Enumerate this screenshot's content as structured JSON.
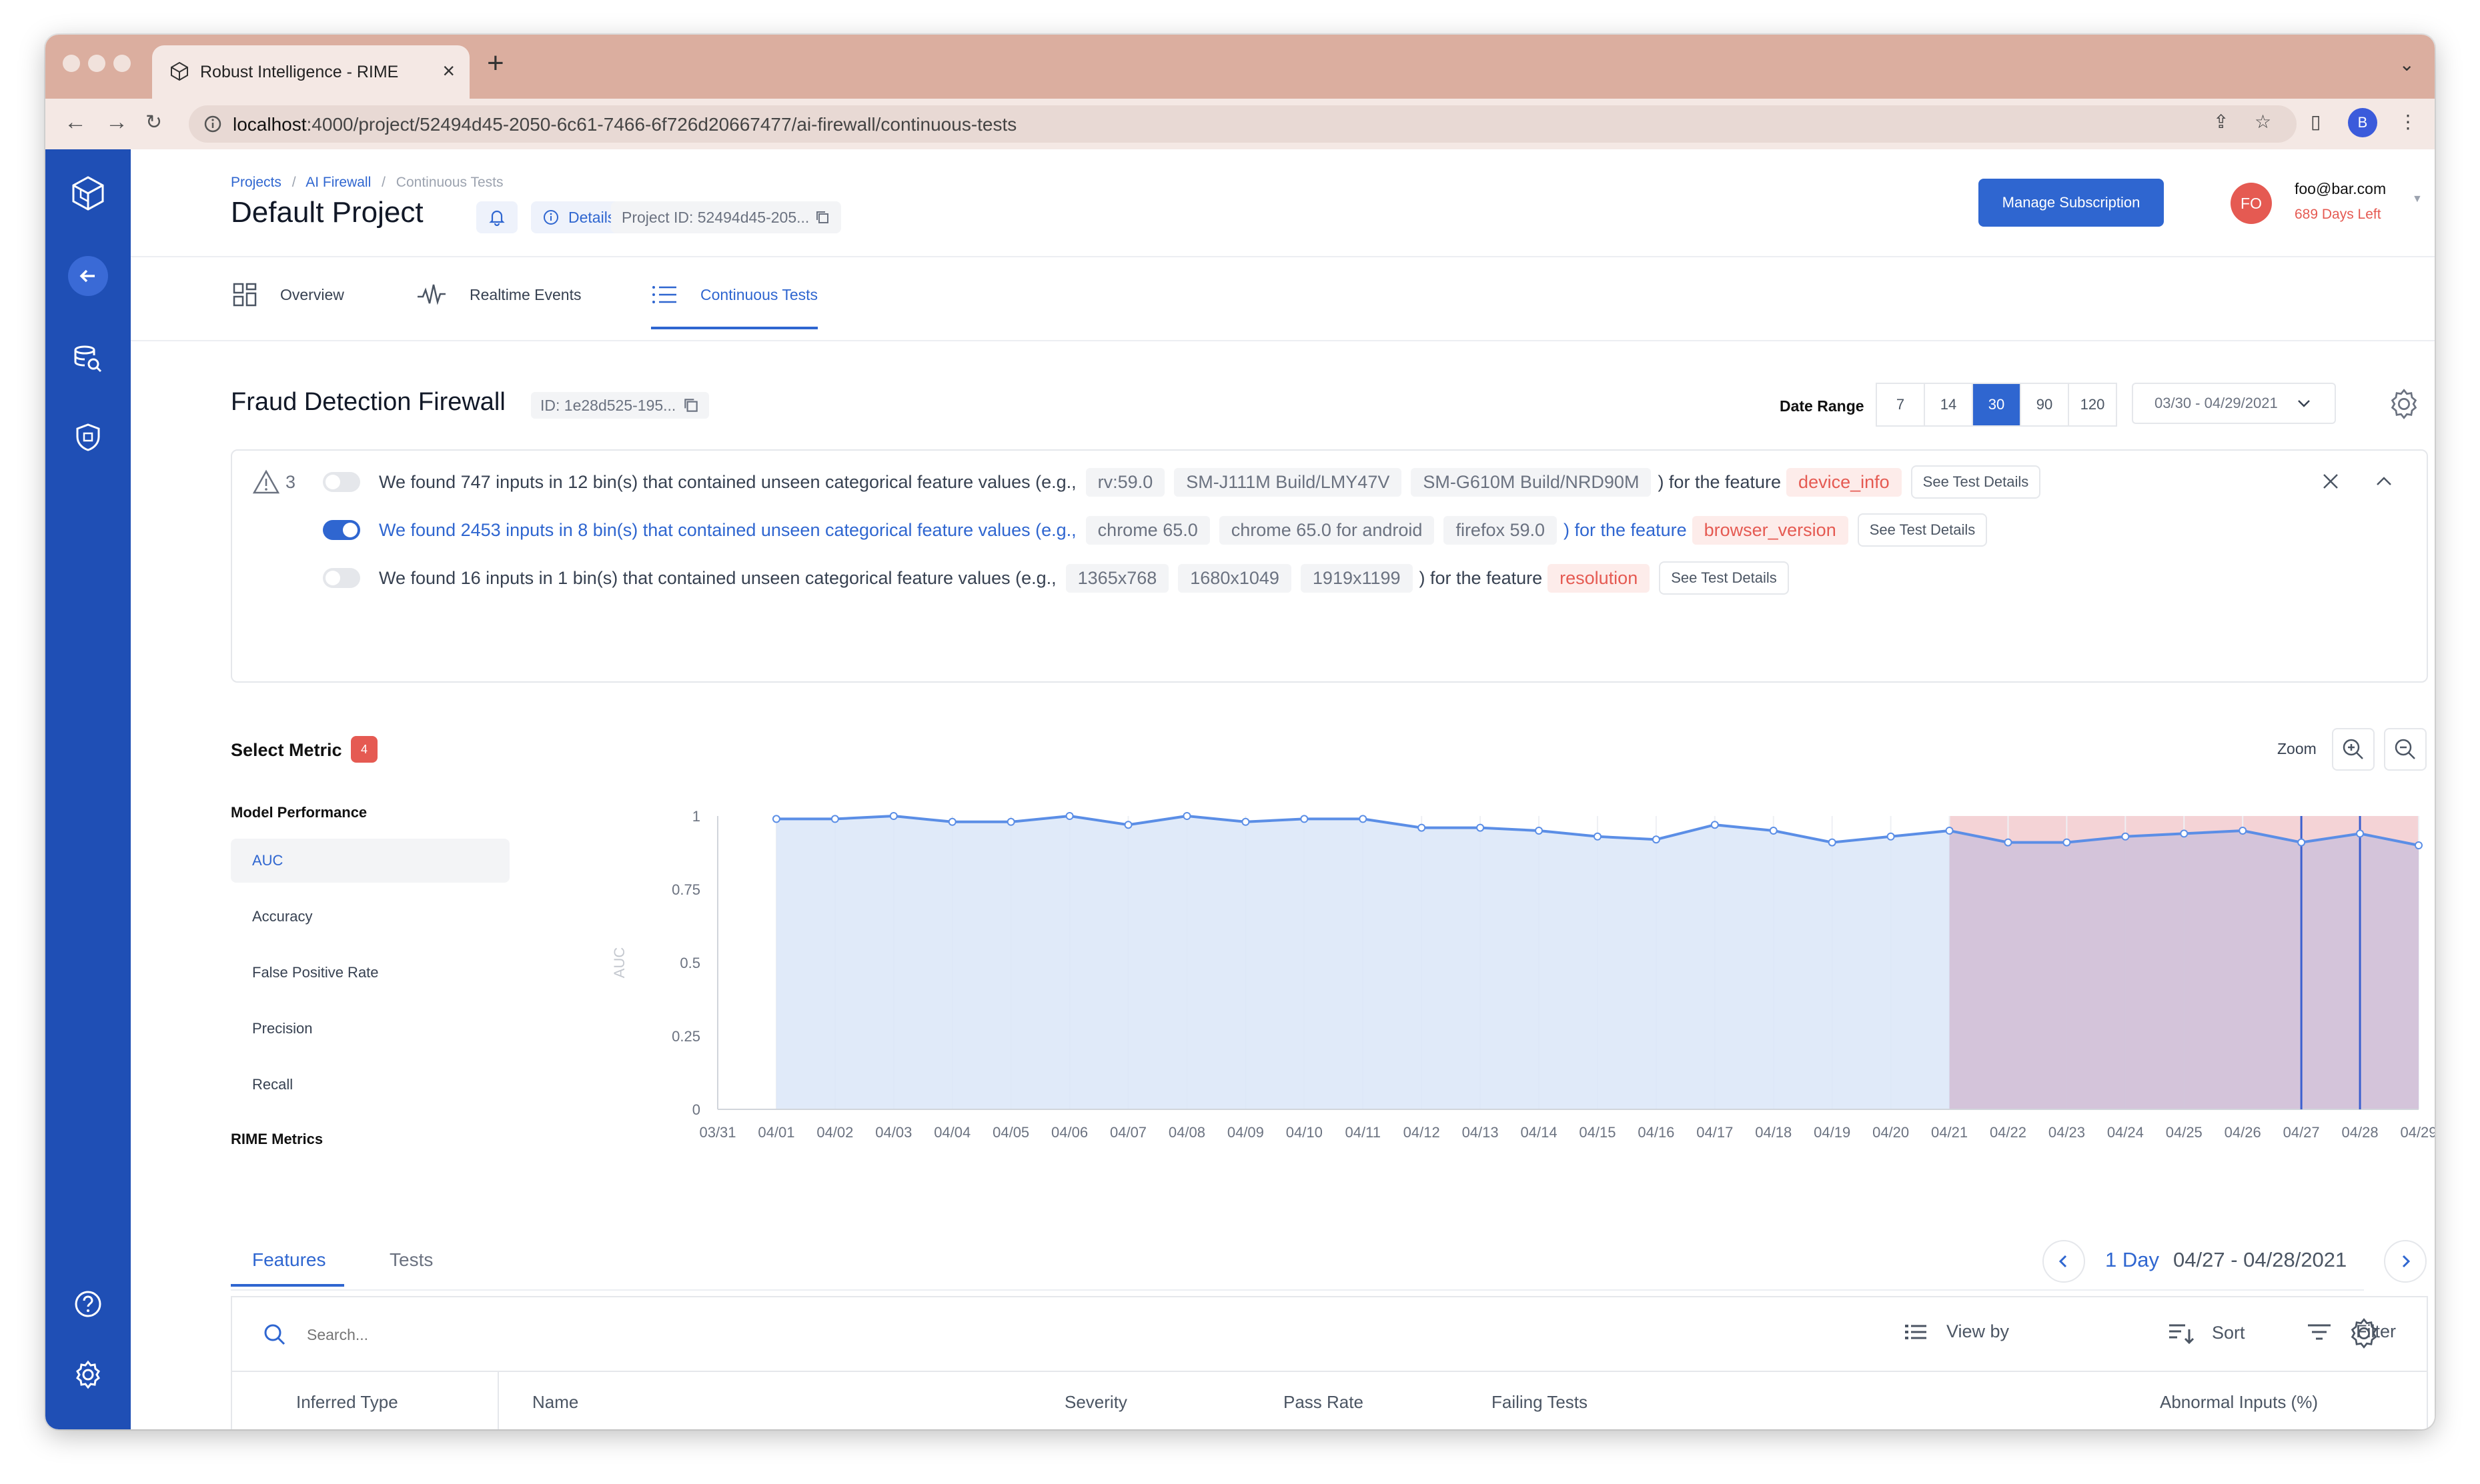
{
  "browser": {
    "tab_title": "Robust Intelligence - RIME",
    "url_host": "localhost",
    "url_rest": ":4000/project/52494d45-2050-6c61-7466-6f726d20667477/ai-firewall/continuous-tests",
    "profile_initial": "B"
  },
  "header": {
    "breadcrumb": [
      "Projects",
      "AI Firewall",
      "Continuous Tests"
    ],
    "project_title": "Default Project",
    "details_label": "Details",
    "project_id": "Project ID: 52494d45-205...",
    "manage_button": "Manage Subscription",
    "avatar_initials": "FO",
    "email": "foo@bar.com",
    "days_left": "689 Days Left"
  },
  "nav_tabs": [
    {
      "label": "Overview"
    },
    {
      "label": "Realtime Events"
    },
    {
      "label": "Continuous Tests"
    }
  ],
  "firewall": {
    "title": "Fraud Detection Firewall",
    "id": "ID: 1e28d525-195...",
    "date_range_label": "Date Range",
    "range_options": [
      "7",
      "14",
      "30",
      "90",
      "120"
    ],
    "selected_range": "30",
    "date_picker": "03/30 - 04/29/2021"
  },
  "alerts": {
    "count": "3",
    "items": [
      {
        "text": "We found 747 inputs in 12 bin(s) that contained unseen categorical feature values (e.g.,",
        "values": [
          "rv:59.0",
          "SM-J111M Build/LMY47V",
          "SM-G610M Build/NRD90M"
        ],
        "suffix": ") for the feature",
        "feature": "device_info",
        "button": "See Test Details",
        "enabled": false
      },
      {
        "text": "We found 2453 inputs in 8 bin(s) that contained unseen categorical feature values (e.g.,",
        "values": [
          "chrome 65.0",
          "chrome 65.0 for android",
          "firefox 59.0"
        ],
        "suffix": ") for the feature",
        "feature": "browser_version",
        "button": "See Test Details",
        "enabled": true
      },
      {
        "text": "We found 16 inputs in 1 bin(s) that contained unseen categorical feature values (e.g.,",
        "values": [
          "1365x768",
          "1680x1049",
          "1919x1199"
        ],
        "suffix": ") for the feature",
        "feature": "resolution",
        "button": "See Test Details",
        "enabled": false
      }
    ]
  },
  "metrics": {
    "select_label": "Select Metric",
    "badge": "4",
    "zoom_label": "Zoom",
    "group_model": "Model Performance",
    "items": [
      "AUC",
      "Accuracy",
      "False Positive Rate",
      "Precision",
      "Recall"
    ],
    "selected": "AUC",
    "group_rime": "RIME Metrics"
  },
  "chart_data": {
    "type": "area",
    "ylabel": "AUC",
    "ylim": [
      0,
      1
    ],
    "yticks": [
      "0",
      "0.25",
      "0.5",
      "0.75",
      "1"
    ],
    "x": [
      "03/31",
      "04/01",
      "04/02",
      "04/03",
      "04/04",
      "04/05",
      "04/06",
      "04/07",
      "04/08",
      "04/09",
      "04/10",
      "04/11",
      "04/12",
      "04/13",
      "04/14",
      "04/15",
      "04/16",
      "04/17",
      "04/18",
      "04/19",
      "04/20",
      "04/21",
      "04/22",
      "04/23",
      "04/24",
      "04/25",
      "04/26",
      "04/27",
      "04/28",
      "04/29"
    ],
    "values": [
      null,
      0.99,
      0.99,
      1.0,
      0.98,
      0.98,
      1.0,
      0.97,
      1.0,
      0.98,
      0.99,
      0.99,
      0.96,
      0.96,
      0.95,
      0.93,
      0.92,
      0.97,
      0.95,
      0.91,
      0.93,
      0.95,
      0.91,
      0.91,
      0.93,
      0.94,
      0.95,
      0.91,
      0.94,
      0.9
    ],
    "highlight_start": "04/21",
    "markers": [
      "04/27",
      "04/28"
    ],
    "colors": {
      "line": "#5b8ee6",
      "fill": "#dbe6f8",
      "alert_fill": "#f4d3d6",
      "marker": "#3a5fcf"
    }
  },
  "bottom": {
    "tabs": [
      "Features",
      "Tests"
    ],
    "period": "1 Day",
    "date_range": "04/27 - 04/28/2021",
    "search_placeholder": "Search...",
    "view_by": "View by",
    "sort": "Sort",
    "filter": "Filter",
    "columns": [
      "Inferred Type",
      "Name",
      "Severity",
      "Pass Rate",
      "Failing Tests",
      "Abnormal Inputs (%)"
    ]
  }
}
